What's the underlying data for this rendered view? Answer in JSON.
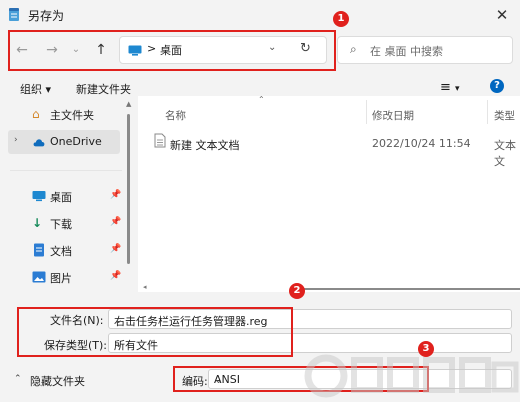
{
  "window": {
    "title": "另存为"
  },
  "nav": {
    "back_icon": "arrow-left-icon",
    "forward_icon": "arrow-right-icon",
    "recent_icon": "chevron-down-icon",
    "up_icon": "arrow-up-icon"
  },
  "address": {
    "separator": ">",
    "location": "桌面"
  },
  "search": {
    "placeholder": "在 桌面 中搜索"
  },
  "toolbar": {
    "organize_label": "组织 ▾",
    "new_folder_label": "新建文件夹"
  },
  "sidebar": {
    "items": [
      {
        "label": "主文件夹"
      },
      {
        "label": "OneDrive"
      },
      {
        "label": "桌面"
      },
      {
        "label": "下载"
      },
      {
        "label": "文档"
      },
      {
        "label": "图片"
      }
    ]
  },
  "columns": {
    "name": "名称",
    "modified": "修改日期",
    "type": "类型"
  },
  "files": [
    {
      "name": "新建 文本文档",
      "modified": "2022/10/24 11:54",
      "type": "文本文"
    }
  ],
  "form": {
    "filename_label": "文件名(N):",
    "filename_value": "右击任务栏运行任务管理器.reg",
    "filetype_label": "保存类型(T):",
    "filetype_value": "所有文件",
    "encoding_label": "编码:",
    "encoding_value": "ANSI"
  },
  "footer": {
    "hide_folders_label": "隐藏文件夹"
  },
  "annotations": {
    "badge1": "1",
    "badge2": "2",
    "badge3": "3"
  },
  "colors": {
    "accent": "#0067c0",
    "annotation_red": "#e0211d"
  }
}
